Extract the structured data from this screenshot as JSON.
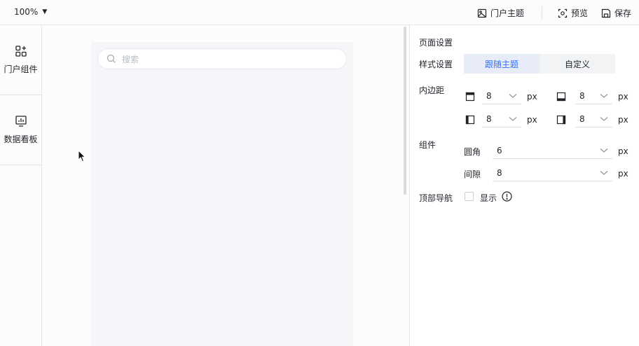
{
  "toolbar": {
    "zoom": "100%",
    "theme_label": "门户主题",
    "preview_label": "预览",
    "save_label": "保存"
  },
  "sidebar": {
    "items": [
      {
        "label": "门户组件",
        "icon": "widgets-icon"
      },
      {
        "label": "数据看板",
        "icon": "dashboard-icon"
      }
    ]
  },
  "canvas": {
    "search_placeholder": "搜索"
  },
  "panel": {
    "page_settings": "页面设置",
    "style_settings": "样式设置",
    "style_options": [
      "跟随主题",
      "自定义"
    ],
    "style_selected": "跟随主题",
    "padding_label": "内边距",
    "padding": {
      "top": "8",
      "bottom": "8",
      "left": "8",
      "right": "8",
      "unit": "px"
    },
    "component_label": "组件",
    "radius_label": "圆角",
    "radius_value": "6",
    "gap_label": "间隙",
    "gap_value": "8",
    "unit": "px",
    "top_nav_label": "顶部导航",
    "show_label": "显示",
    "show_checked": false
  },
  "colors": {
    "accent": "#3370ff",
    "segment_active_bg": "#e7ecf8",
    "canvas_bg": "#f5f6fa"
  }
}
